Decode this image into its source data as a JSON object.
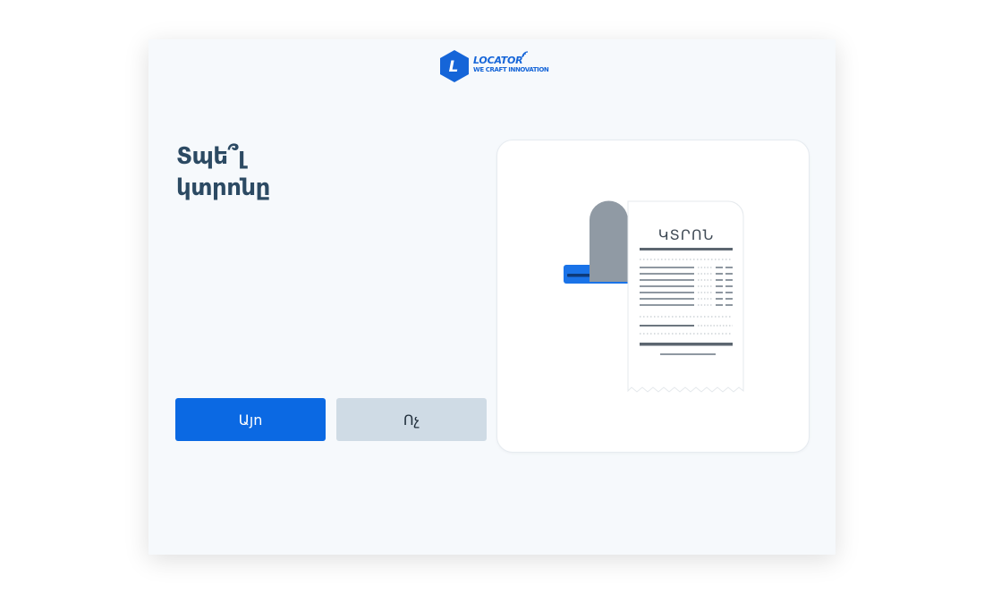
{
  "app": {
    "brand_name": "LOCATOR",
    "brand_tagline": "WE CRAFT INNOVATION",
    "brand_initial": "L",
    "brand_color": "#1565d8"
  },
  "prompt": {
    "line1": "Տպե՞լ",
    "line2": "կտրոնը"
  },
  "buttons": {
    "yes_label": "Այո",
    "no_label": "Ոչ"
  },
  "receipt": {
    "heading": "ԿՏՐՈՆ"
  },
  "colors": {
    "primary": "#0b69e3",
    "secondary": "#cfdbe5",
    "title": "#2c4a63",
    "background": "#f6f9fc"
  },
  "icons": {
    "logo": "locator-hexagon-logo",
    "signal": "wireless-signal-icon",
    "illustration": "receipt-printer-illustration"
  }
}
